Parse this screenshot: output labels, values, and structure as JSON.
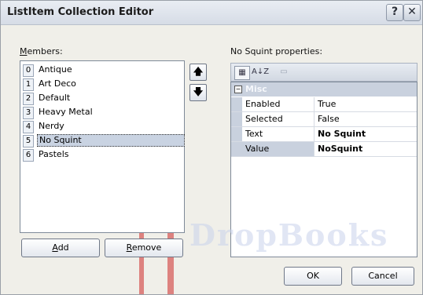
{
  "window": {
    "title": "ListItem Collection Editor",
    "help_glyph": "?",
    "close_glyph": "✕"
  },
  "members": {
    "label": "Members:",
    "items": [
      {
        "index": "0",
        "text": "Antique",
        "selected": false
      },
      {
        "index": "1",
        "text": "Art Deco",
        "selected": false
      },
      {
        "index": "2",
        "text": "Default",
        "selected": false
      },
      {
        "index": "3",
        "text": "Heavy Metal",
        "selected": false
      },
      {
        "index": "4",
        "text": "Nerdy",
        "selected": false
      },
      {
        "index": "5",
        "text": "No Squint",
        "selected": true
      },
      {
        "index": "6",
        "text": "Pastels",
        "selected": false
      }
    ],
    "move_up_glyph": "🡅",
    "move_down_glyph": "🡇",
    "add_label": "Add",
    "remove_label": "Remove"
  },
  "properties": {
    "label": "No Squint properties:",
    "toolbar": {
      "categorized_icon": "▦",
      "alphabetical_icon": "A↓Z",
      "pages_icon": "▭"
    },
    "category": {
      "name": "Misc",
      "toggle_glyph": "−"
    },
    "rows": [
      {
        "name": "Enabled",
        "value": "True",
        "bold": false,
        "selected": false
      },
      {
        "name": "Selected",
        "value": "False",
        "bold": false,
        "selected": false
      },
      {
        "name": "Text",
        "value": "No Squint",
        "bold": true,
        "selected": false
      },
      {
        "name": "Value",
        "value": "NoSquint",
        "bold": true,
        "selected": true
      }
    ]
  },
  "footer": {
    "ok_label": "OK",
    "cancel_label": "Cancel"
  },
  "watermark": {
    "text": "DropBooks"
  },
  "colors": {
    "accent": "#c9d1de",
    "selection": "#c9d3e2",
    "stripe": "#ce2828"
  }
}
